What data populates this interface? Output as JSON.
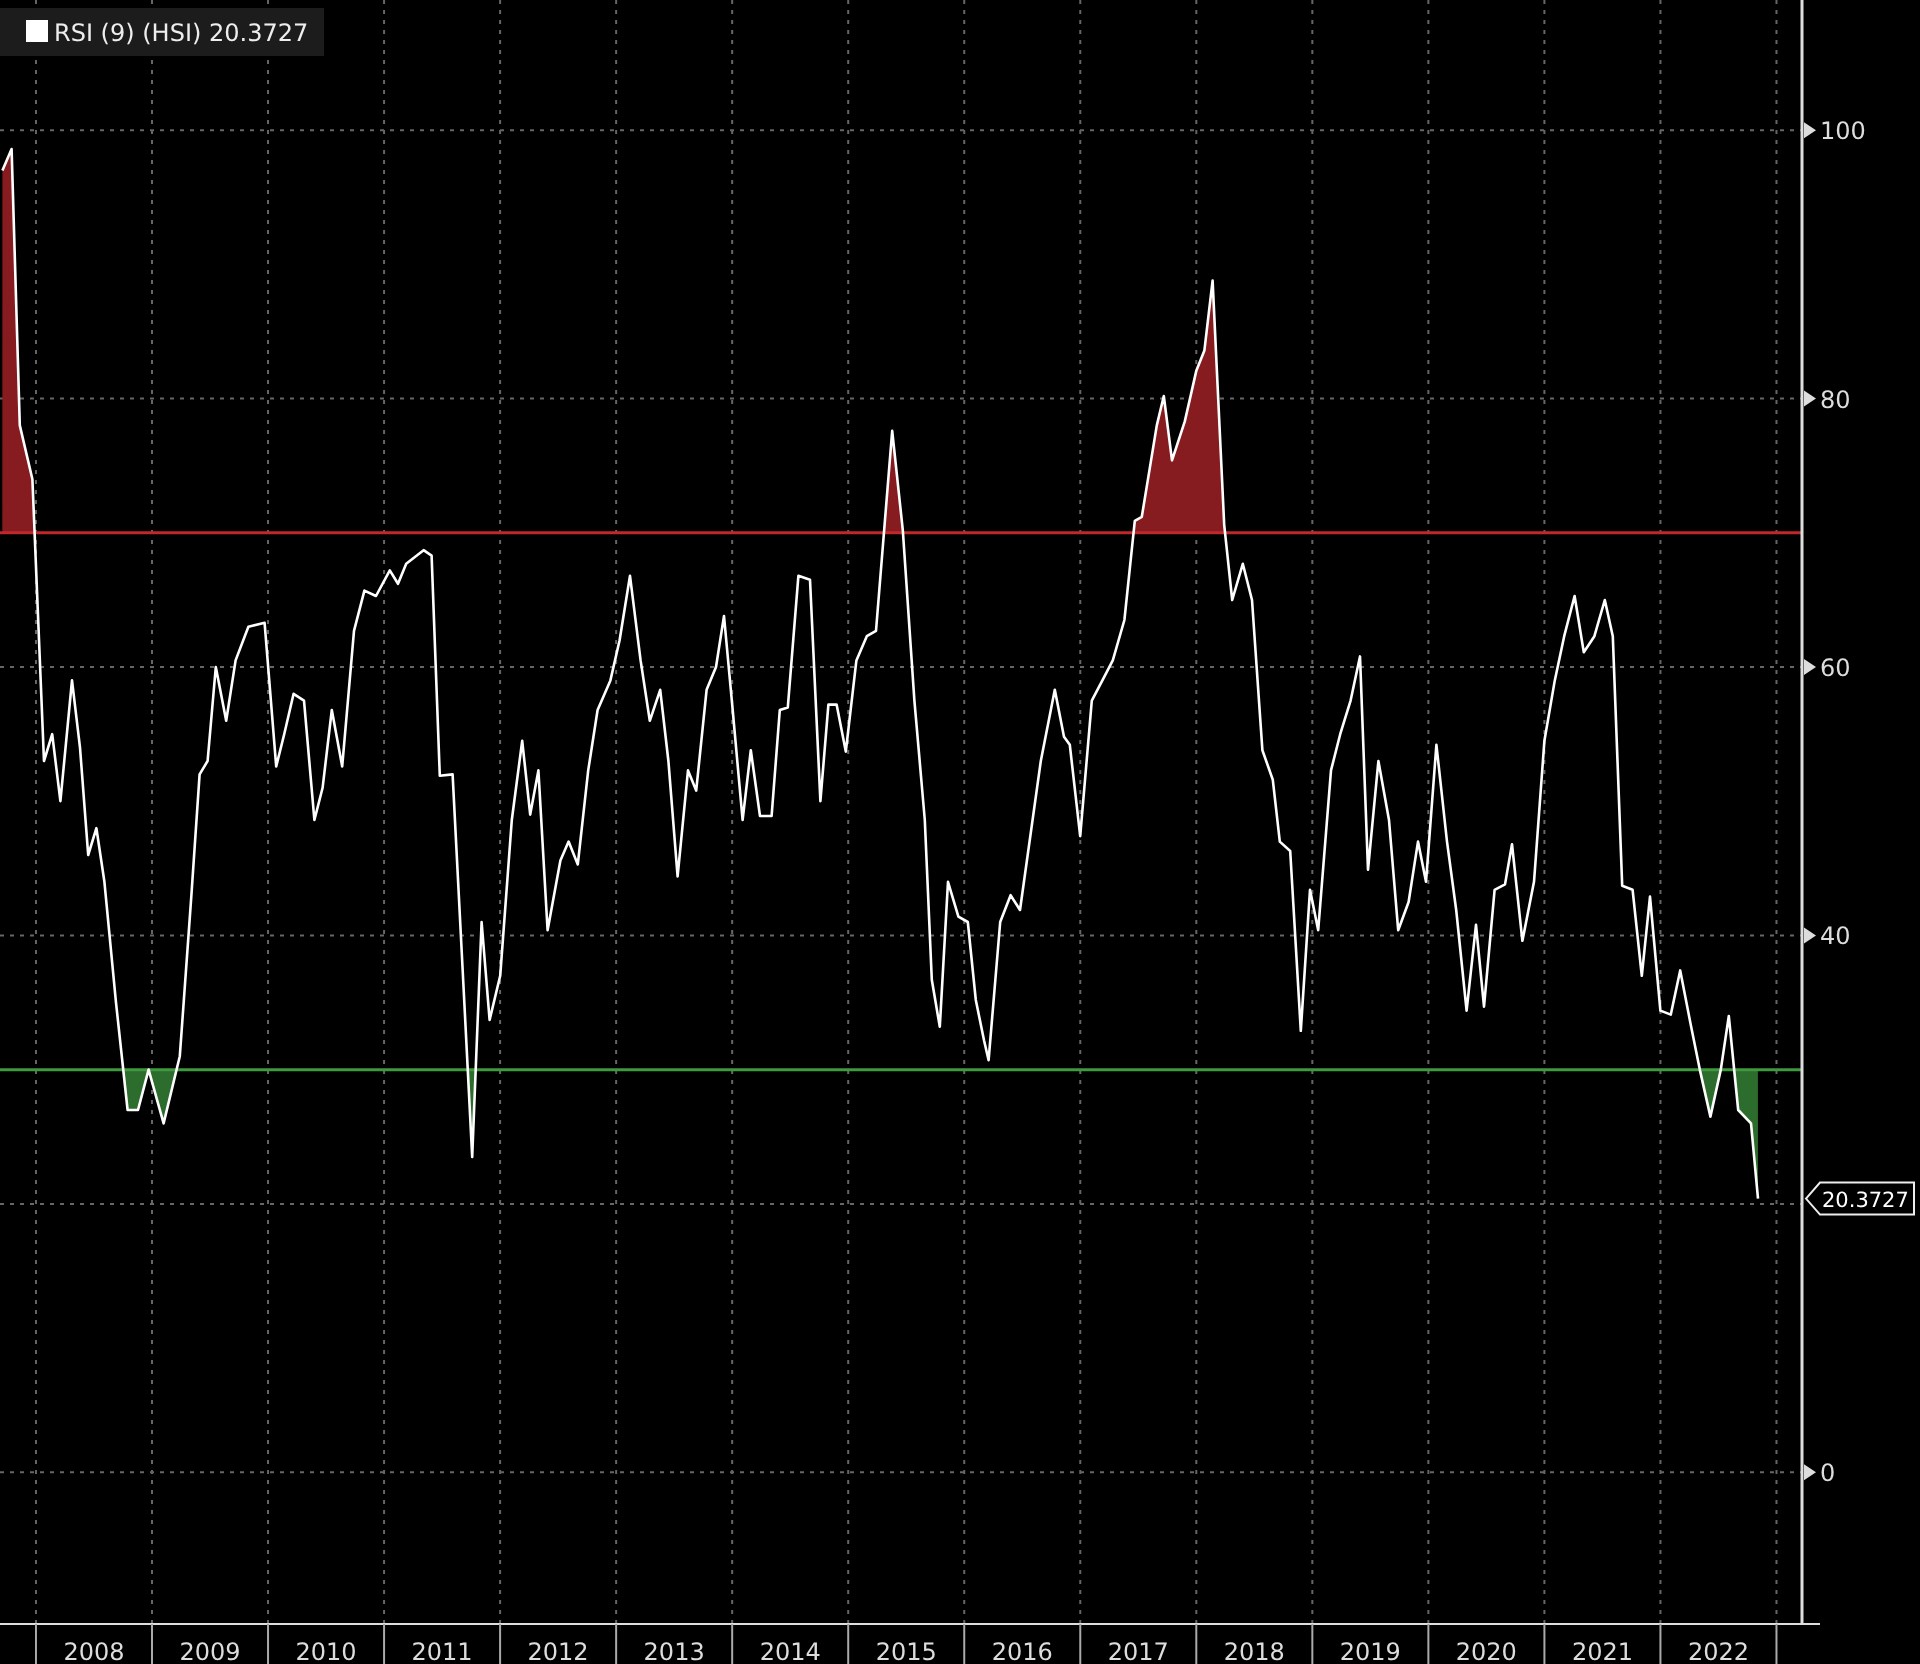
{
  "legend": {
    "value": "20.3727"
  },
  "chart_data": {
    "type": "line",
    "x": [
      2007.71,
      2007.79,
      2007.86,
      2007.97,
      2008.07,
      2008.14,
      2008.21,
      2008.31,
      2008.38,
      2008.45,
      2008.52,
      2008.59,
      2008.69,
      2008.79,
      2008.88,
      2008.97,
      2009.1,
      2009.24,
      2009.34,
      2009.41,
      2009.48,
      2009.55,
      2009.64,
      2009.72,
      2009.83,
      2009.97,
      2010.07,
      2010.14,
      2010.22,
      2010.31,
      2010.4,
      2010.47,
      2010.55,
      2010.64,
      2010.74,
      2010.83,
      2010.93,
      2011.05,
      2011.12,
      2011.19,
      2011.34,
      2011.41,
      2011.48,
      2011.59,
      2011.69,
      2011.76,
      2011.84,
      2011.91,
      2012.0,
      2012.1,
      2012.19,
      2012.26,
      2012.33,
      2012.41,
      2012.52,
      2012.59,
      2012.67,
      2012.76,
      2012.84,
      2012.95,
      2013.03,
      2013.12,
      2013.21,
      2013.29,
      2013.38,
      2013.45,
      2013.53,
      2013.62,
      2013.69,
      2013.78,
      2013.86,
      2013.93,
      2014.0,
      2014.09,
      2014.16,
      2014.24,
      2014.34,
      2014.41,
      2014.48,
      2014.57,
      2014.67,
      2014.76,
      2014.83,
      2014.9,
      2014.98,
      2015.07,
      2015.16,
      2015.24,
      2015.38,
      2015.47,
      2015.57,
      2015.66,
      2015.72,
      2015.79,
      2015.86,
      2015.95,
      2016.03,
      2016.1,
      2016.17,
      2016.21,
      2016.31,
      2016.4,
      2016.48,
      2016.66,
      2016.78,
      2016.86,
      2016.91,
      2017.0,
      2017.1,
      2017.19,
      2017.28,
      2017.38,
      2017.47,
      2017.53,
      2017.66,
      2017.72,
      2017.79,
      2017.9,
      2018.0,
      2018.07,
      2018.14,
      2018.24,
      2018.31,
      2018.4,
      2018.48,
      2018.57,
      2018.66,
      2018.72,
      2018.81,
      2018.9,
      2018.98,
      2019.05,
      2019.16,
      2019.24,
      2019.33,
      2019.41,
      2019.48,
      2019.57,
      2019.66,
      2019.74,
      2019.83,
      2019.91,
      2019.98,
      2020.07,
      2020.16,
      2020.24,
      2020.33,
      2020.41,
      2020.48,
      2020.57,
      2020.66,
      2020.72,
      2020.81,
      2020.91,
      2021.0,
      2021.09,
      2021.17,
      2021.26,
      2021.34,
      2021.43,
      2021.52,
      2021.59,
      2021.67,
      2021.76,
      2021.84,
      2021.91,
      2022.0,
      2022.09,
      2022.17,
      2022.26,
      2022.34,
      2022.43,
      2022.52,
      2022.59,
      2022.67,
      2022.78,
      2022.84
    ],
    "series": [
      {
        "name": "RSI (9) (HSI)",
        "color": "#ffffff",
        "values": [
          97,
          98.6,
          78,
          74,
          53,
          55,
          50,
          59,
          54,
          46,
          48,
          44,
          35,
          27,
          27,
          30,
          26,
          31,
          43,
          52,
          53,
          60,
          56,
          60.5,
          63,
          63.3,
          52.6,
          55,
          58,
          57.5,
          48.6,
          51,
          56.8,
          52.6,
          62.7,
          65.7,
          65.3,
          67.2,
          66.2,
          67.7,
          68.7,
          68.3,
          51.9,
          52,
          35.2,
          23.5,
          41,
          33.7,
          37,
          48.6,
          54.5,
          49,
          52.3,
          40.4,
          45.6,
          47,
          45.3,
          52.3,
          56.8,
          59,
          62,
          66.8,
          60.5,
          56,
          58.3,
          53,
          44.4,
          52.3,
          50.8,
          58.3,
          60,
          63.8,
          57.2,
          48.6,
          53.8,
          48.9,
          48.9,
          56.8,
          57,
          66.8,
          66.5,
          50,
          57.2,
          57.2,
          53.7,
          60.5,
          62.3,
          62.7,
          77.6,
          70.2,
          57.5,
          48.6,
          36.7,
          33.2,
          44,
          41.4,
          41,
          35.2,
          32.2,
          30.7,
          41,
          43,
          41.9,
          53,
          58.3,
          54.8,
          54.2,
          47.4,
          57.5,
          59,
          60.5,
          63.5,
          70.9,
          71.2,
          78,
          80.2,
          75.4,
          78.3,
          82.1,
          83.6,
          88.8,
          70.6,
          65,
          67.7,
          65,
          53.8,
          51.6,
          47,
          46.3,
          32.9,
          43.4,
          40.4,
          52.3,
          55,
          57.5,
          60.8,
          44.9,
          53,
          48.6,
          40.4,
          42.5,
          47,
          44,
          54.2,
          47,
          41.9,
          34.4,
          40.8,
          34.7,
          43.4,
          43.8,
          46.8,
          39.6,
          44,
          54.5,
          59,
          62.3,
          65.3,
          61.1,
          62.3,
          65,
          62.3,
          43.7,
          43.4,
          37,
          42.9,
          34.4,
          34.1,
          37.4,
          33.4,
          30,
          26.5,
          30,
          34,
          27,
          26,
          20.4
        ]
      }
    ],
    "xlim": [
      2007.69,
      2023.22
    ],
    "ylim": [
      -11.3,
      109.7
    ],
    "xticks": [
      {
        "value": 2008.5,
        "label": "2008"
      },
      {
        "value": 2009.5,
        "label": "2009"
      },
      {
        "value": 2010.5,
        "label": "2010"
      },
      {
        "value": 2011.5,
        "label": "2011"
      },
      {
        "value": 2012.5,
        "label": "2012"
      },
      {
        "value": 2013.5,
        "label": "2013"
      },
      {
        "value": 2014.5,
        "label": "2014"
      },
      {
        "value": 2015.5,
        "label": "2015"
      },
      {
        "value": 2016.5,
        "label": "2016"
      },
      {
        "value": 2017.5,
        "label": "2017"
      },
      {
        "value": 2018.5,
        "label": "2018"
      },
      {
        "value": 2019.5,
        "label": "2019"
      },
      {
        "value": 2020.5,
        "label": "2020"
      },
      {
        "value": 2021.5,
        "label": "2021"
      },
      {
        "value": 2022.5,
        "label": "2022"
      }
    ],
    "yticks": [
      0,
      40,
      60,
      80,
      100
    ],
    "grid": true,
    "ref_lines": [
      {
        "axis": "y",
        "value": 70,
        "color": "#c0282c"
      },
      {
        "axis": "y",
        "value": 30,
        "color": "#3f9a3f"
      }
    ],
    "annotations": [
      "20.3727"
    ]
  }
}
